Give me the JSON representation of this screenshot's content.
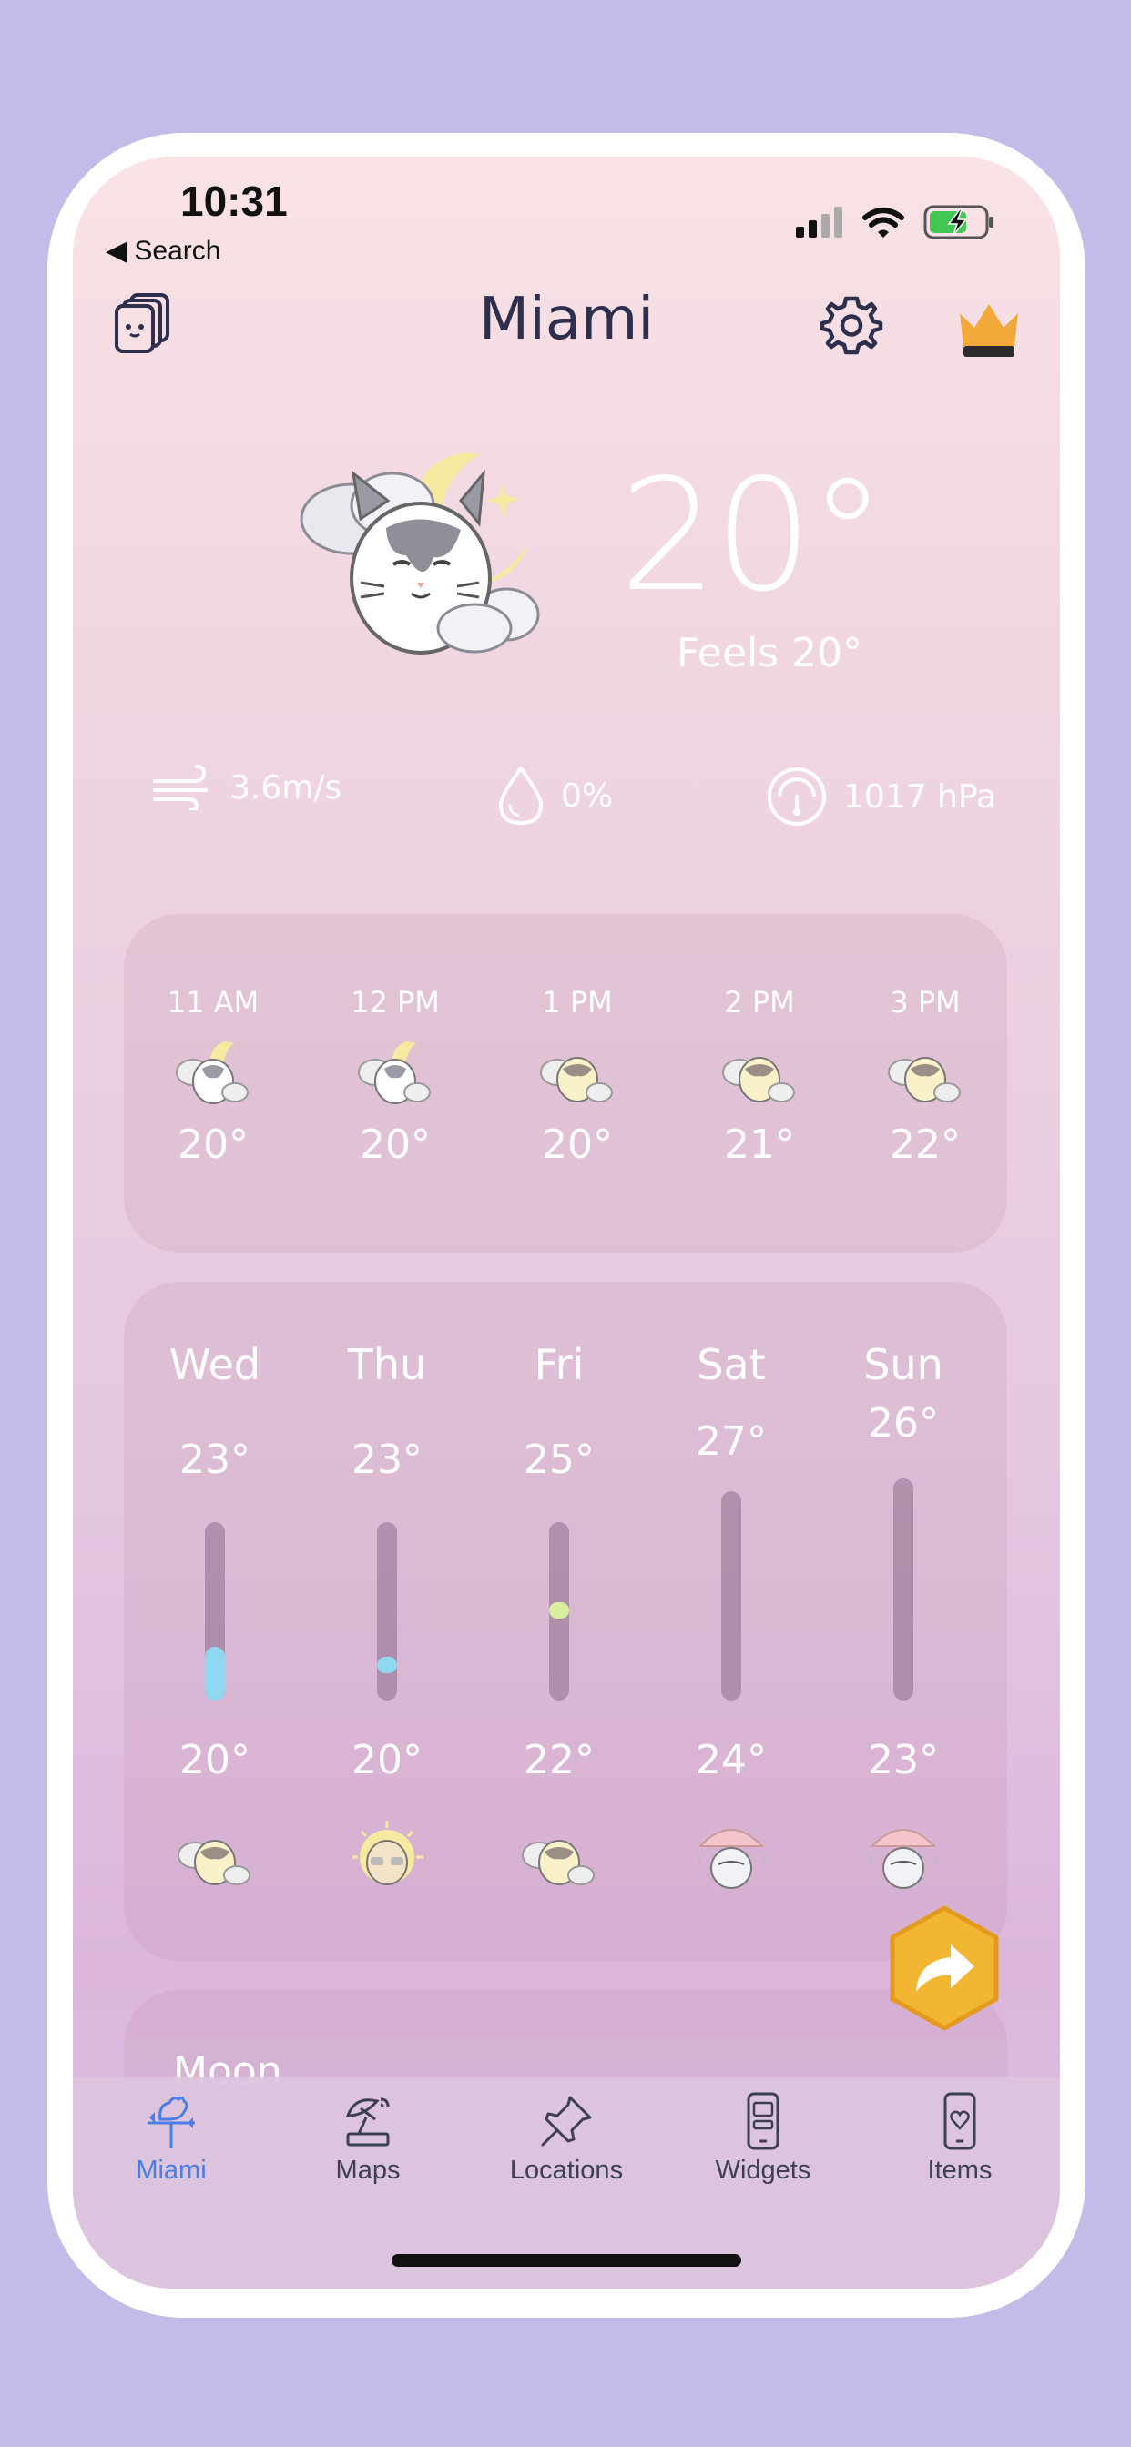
{
  "status_bar": {
    "time": "10:31",
    "back_label": "Search"
  },
  "header": {
    "title": "Miami"
  },
  "current": {
    "temperature": "20°",
    "feels_like": "Feels 20°"
  },
  "stats": {
    "wind": "3.6m/s",
    "precipitation": "0%",
    "pressure": "1017 hPa"
  },
  "hourly": [
    {
      "time": "11 AM",
      "temp": "20°",
      "icon": "cat-night-cloud-icon"
    },
    {
      "time": "12 PM",
      "temp": "20°",
      "icon": "cat-night-cloud-icon"
    },
    {
      "time": "1 PM",
      "temp": "20°",
      "icon": "cat-cloud-icon"
    },
    {
      "time": "2 PM",
      "temp": "21°",
      "icon": "cat-cloud-icon"
    },
    {
      "time": "3 PM",
      "temp": "22°",
      "icon": "cat-cloud-icon"
    }
  ],
  "daily": [
    {
      "day": "Wed",
      "high": "23°",
      "low": "20°",
      "icon": "cat-cloud-icon",
      "range_fraction": 0.3,
      "range_color": "#8fd8f0"
    },
    {
      "day": "Thu",
      "high": "23°",
      "low": "20°",
      "icon": "cat-sun-icon",
      "range_fraction": 0.05,
      "range_color": "#8fd8f0"
    },
    {
      "day": "Fri",
      "high": "25°",
      "low": "22°",
      "icon": "cat-cloud-icon",
      "range_fraction": 0.05,
      "range_color": "#d8efa0"
    },
    {
      "day": "Sat",
      "high": "27°",
      "low": "24°",
      "icon": "cat-umbrella-icon",
      "range_fraction": 0,
      "range_color": ""
    },
    {
      "day": "Sun",
      "high": "26°",
      "low": "23°",
      "icon": "cat-umbrella-icon",
      "range_fraction": 0,
      "range_color": ""
    }
  ],
  "moon": {
    "label": "Moon"
  },
  "tabs": [
    {
      "label": "Miami",
      "icon": "weathervane-icon",
      "active": true
    },
    {
      "label": "Maps",
      "icon": "satellite-dish-icon",
      "active": false
    },
    {
      "label": "Locations",
      "icon": "pushpin-icon",
      "active": false
    },
    {
      "label": "Widgets",
      "icon": "phone-widget-icon",
      "active": false
    },
    {
      "label": "Items",
      "icon": "phone-heart-icon",
      "active": false
    }
  ],
  "colors": {
    "background": "#c3bce8",
    "accent": "#4a7de6",
    "crown": "#f3a83a",
    "fab": "#f2b632",
    "text_dark": "#2d2f4d"
  }
}
